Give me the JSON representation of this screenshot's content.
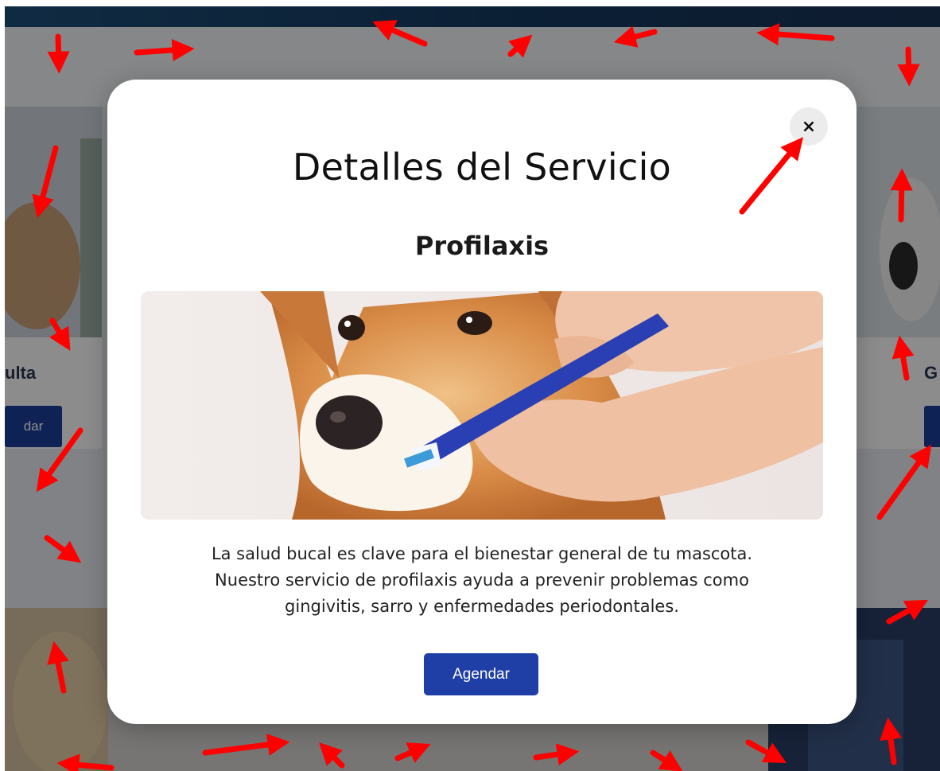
{
  "modal": {
    "title": "Detalles del Servicio",
    "close_icon": "×",
    "service_name": "Profilaxis",
    "description_lines": [
      "La salud bucal es clave para el bienestar general de tu mascota.",
      "Nuestro servicio de profilaxis ayuda a prevenir problemas como",
      "gingivitis, sarro y enfermedades periodontales."
    ],
    "book_label": "Agendar"
  },
  "background": {
    "left_card_title": "ulta",
    "left_card_button": "dar",
    "right_card_title": "G"
  },
  "colors": {
    "accent": "#1f3fa6",
    "overlay_arrow": "#ff0000",
    "topbar": "#14385e"
  }
}
